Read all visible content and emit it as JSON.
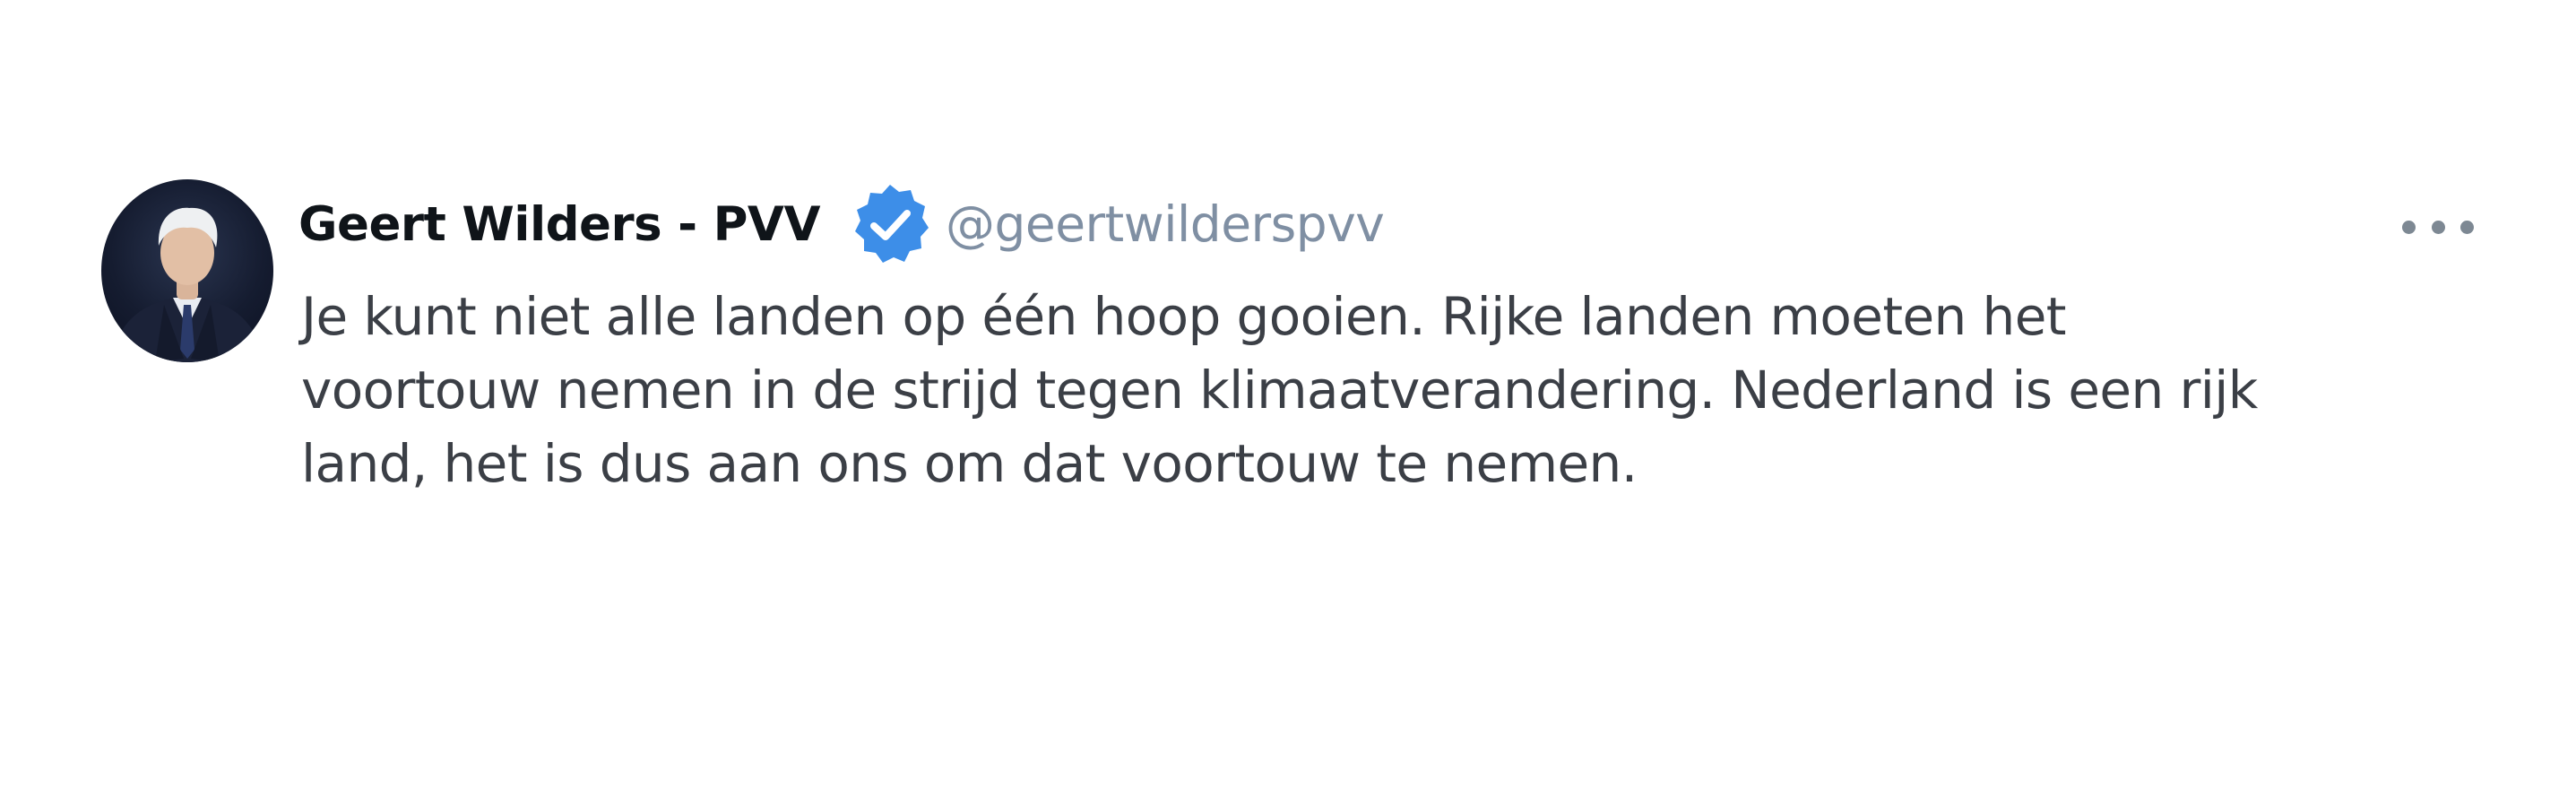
{
  "tweet": {
    "author_name": "Geert Wilders - PVV",
    "handle": "@geertwilderspvv",
    "verified": true,
    "text_lines": [
      "Je kunt niet alle landen op één hoop gooien. Rijke landen moeten het",
      "voortouw nemen in de strijd tegen klimaatverandering. Nederland is een rijk",
      "land, het is dus aan ons om dat voortouw te nemen."
    ]
  },
  "icons": {
    "verified": "verified-badge-icon",
    "more": "more-options-icon",
    "avatar": "profile-photo"
  },
  "colors": {
    "verified_badge": "#3d8ee8",
    "handle": "#7f8fa3",
    "text": "#3b3f46",
    "name": "#0f1419"
  }
}
